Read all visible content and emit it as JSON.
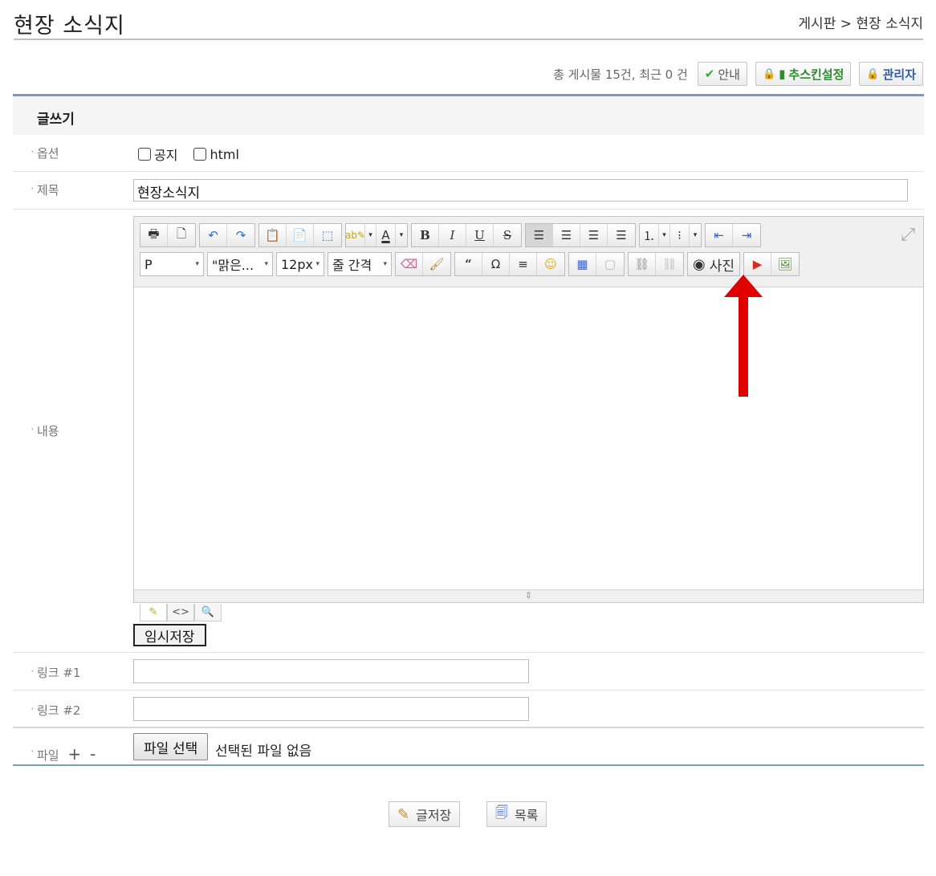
{
  "header": {
    "page_title": "현장 소식지",
    "breadcrumb": "게시판 > 현장 소식지"
  },
  "topbar": {
    "post_count": "총 게시물 15건, 최근 0 건",
    "guide_label": "안내",
    "skin_label": "추스킨설정",
    "admin_label": "관리자"
  },
  "form": {
    "heading": "글쓰기",
    "option_label": "옵션",
    "notice_label": "공지",
    "html_label": "html",
    "subject_label": "제목",
    "subject_value": "현장소식지",
    "content_label": "내용",
    "link1_label": "링크 #1",
    "link2_label": "링크 #2",
    "file_label": "파일",
    "file_button": "파일 선택",
    "file_status": "선택된 파일 없음",
    "draft_button": "임시저장"
  },
  "editor": {
    "paragraph_format": "P",
    "font_family": "\"맑은...",
    "font_size": "12px",
    "line_height": "줄 간격",
    "photo_button": "사진",
    "icons": [
      "print-icon",
      "new-page-icon",
      "undo-icon",
      "redo-icon",
      "paste-icon",
      "paste-word-icon",
      "select-all-icon",
      "highlight-icon",
      "font-color-icon",
      "bold-icon",
      "italic-icon",
      "underline-icon",
      "strike-icon",
      "align-left-icon",
      "align-center-icon",
      "align-right-icon",
      "justify-icon",
      "ordered-list-icon",
      "unordered-list-icon",
      "outdent-icon",
      "indent-icon",
      "eraser-icon",
      "brush-icon",
      "quote-icon",
      "omega-icon",
      "hr-icon",
      "emoticon-icon",
      "table-icon",
      "template-icon",
      "link-icon",
      "unlink-icon",
      "camera-icon",
      "youtube-icon",
      "image-icon",
      "expand-icon"
    ],
    "accent_colors": {
      "youtube": "#d62d20",
      "arrow": "#e00000",
      "check": "#3aa83a"
    }
  },
  "actions": {
    "save_label": "글저장",
    "list_label": "목록"
  }
}
